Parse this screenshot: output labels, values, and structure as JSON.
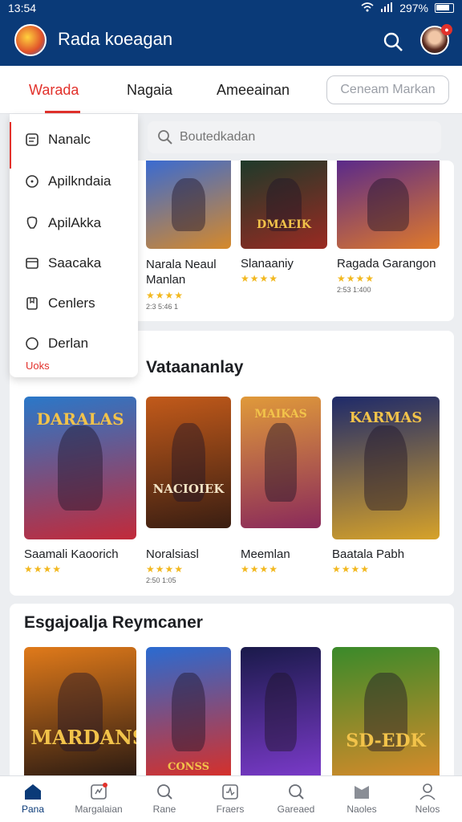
{
  "status": {
    "time": "13:54",
    "battery": "297%"
  },
  "app": {
    "title": "Rada koeagan"
  },
  "tabs": [
    {
      "label": "Warada"
    },
    {
      "label": "Nagaia"
    },
    {
      "label": "Ameeainan"
    }
  ],
  "tab_button": {
    "label": "Ceneam Markan"
  },
  "search": {
    "placeholder": "Boutedkadan"
  },
  "menu": {
    "items": [
      {
        "label": "Nanalc",
        "icon": "list-icon"
      },
      {
        "label": "Apilkndaia",
        "icon": "info-icon"
      },
      {
        "label": "ApilAkka",
        "icon": "badge-icon"
      },
      {
        "label": "Saacaka",
        "icon": "box-icon"
      },
      {
        "label": "Cenlers",
        "icon": "bookmark-icon"
      },
      {
        "label": "Derlan",
        "icon": "circle-icon"
      }
    ],
    "more": "Uoks"
  },
  "section1": {
    "cards": [
      {
        "name": "Narala Neaul\nManlan",
        "stars": "★★★★",
        "count": "2:3 5:46 1",
        "poster": "",
        "colors": [
          "#3a6bd1",
          "#d6892a"
        ]
      },
      {
        "name": "Slanaaniy",
        "stars": "★★★★",
        "count": "",
        "poster": "DMAEIK",
        "colors": [
          "#1e3a2a",
          "#9a2a22"
        ]
      },
      {
        "name": "Ragada Garangon",
        "stars": "★★★★",
        "count": "2:53 1:400",
        "poster": "",
        "colors": [
          "#5a2a8a",
          "#e07a2a"
        ]
      }
    ]
  },
  "section2": {
    "title": "Vataananlay",
    "cards": [
      {
        "name": "Saamali Kaoorich",
        "stars": "★★★★",
        "count": "",
        "poster": "DARALAS",
        "colors": [
          "#2a78c9",
          "#c22a3a"
        ]
      },
      {
        "name": "Noralsiasl",
        "stars": "★★★★",
        "count": "2:50 1:05",
        "poster": "NACIOIEK",
        "colors": [
          "#c25a1a",
          "#3a1e12"
        ]
      },
      {
        "name": "Meemlan",
        "stars": "★★★★",
        "count": "",
        "poster": "MAIKAS",
        "colors": [
          "#e09a3a",
          "#8a2a5a"
        ]
      },
      {
        "name": "Baatala Pabh",
        "stars": "★★★★",
        "count": "",
        "poster": "KARMAS",
        "colors": [
          "#1e2a6a",
          "#d6a22a"
        ]
      }
    ]
  },
  "section3": {
    "title": "Esgajoalja Reymcaner",
    "cards": [
      {
        "poster": "MARDANS",
        "colors": [
          "#e07a1a",
          "#2a1a12"
        ]
      },
      {
        "poster": "CONSS",
        "colors": [
          "#2a6bd1",
          "#d6302a"
        ]
      },
      {
        "poster": "",
        "colors": [
          "#1a1a4a",
          "#7a3ac9"
        ]
      },
      {
        "poster": "SD-EDK",
        "colors": [
          "#3a8a2a",
          "#d68a2a"
        ]
      }
    ]
  },
  "bottom_nav": [
    {
      "label": "Pana",
      "icon": "home-icon"
    },
    {
      "label": "Margalaian",
      "icon": "store-icon"
    },
    {
      "label": "Rane",
      "icon": "search-icon"
    },
    {
      "label": "Fraers",
      "icon": "chart-icon"
    },
    {
      "label": "Gareaed",
      "icon": "magnify-icon"
    },
    {
      "label": "Naoles",
      "icon": "folder-icon"
    },
    {
      "label": "Nelos",
      "icon": "profile-icon"
    }
  ]
}
